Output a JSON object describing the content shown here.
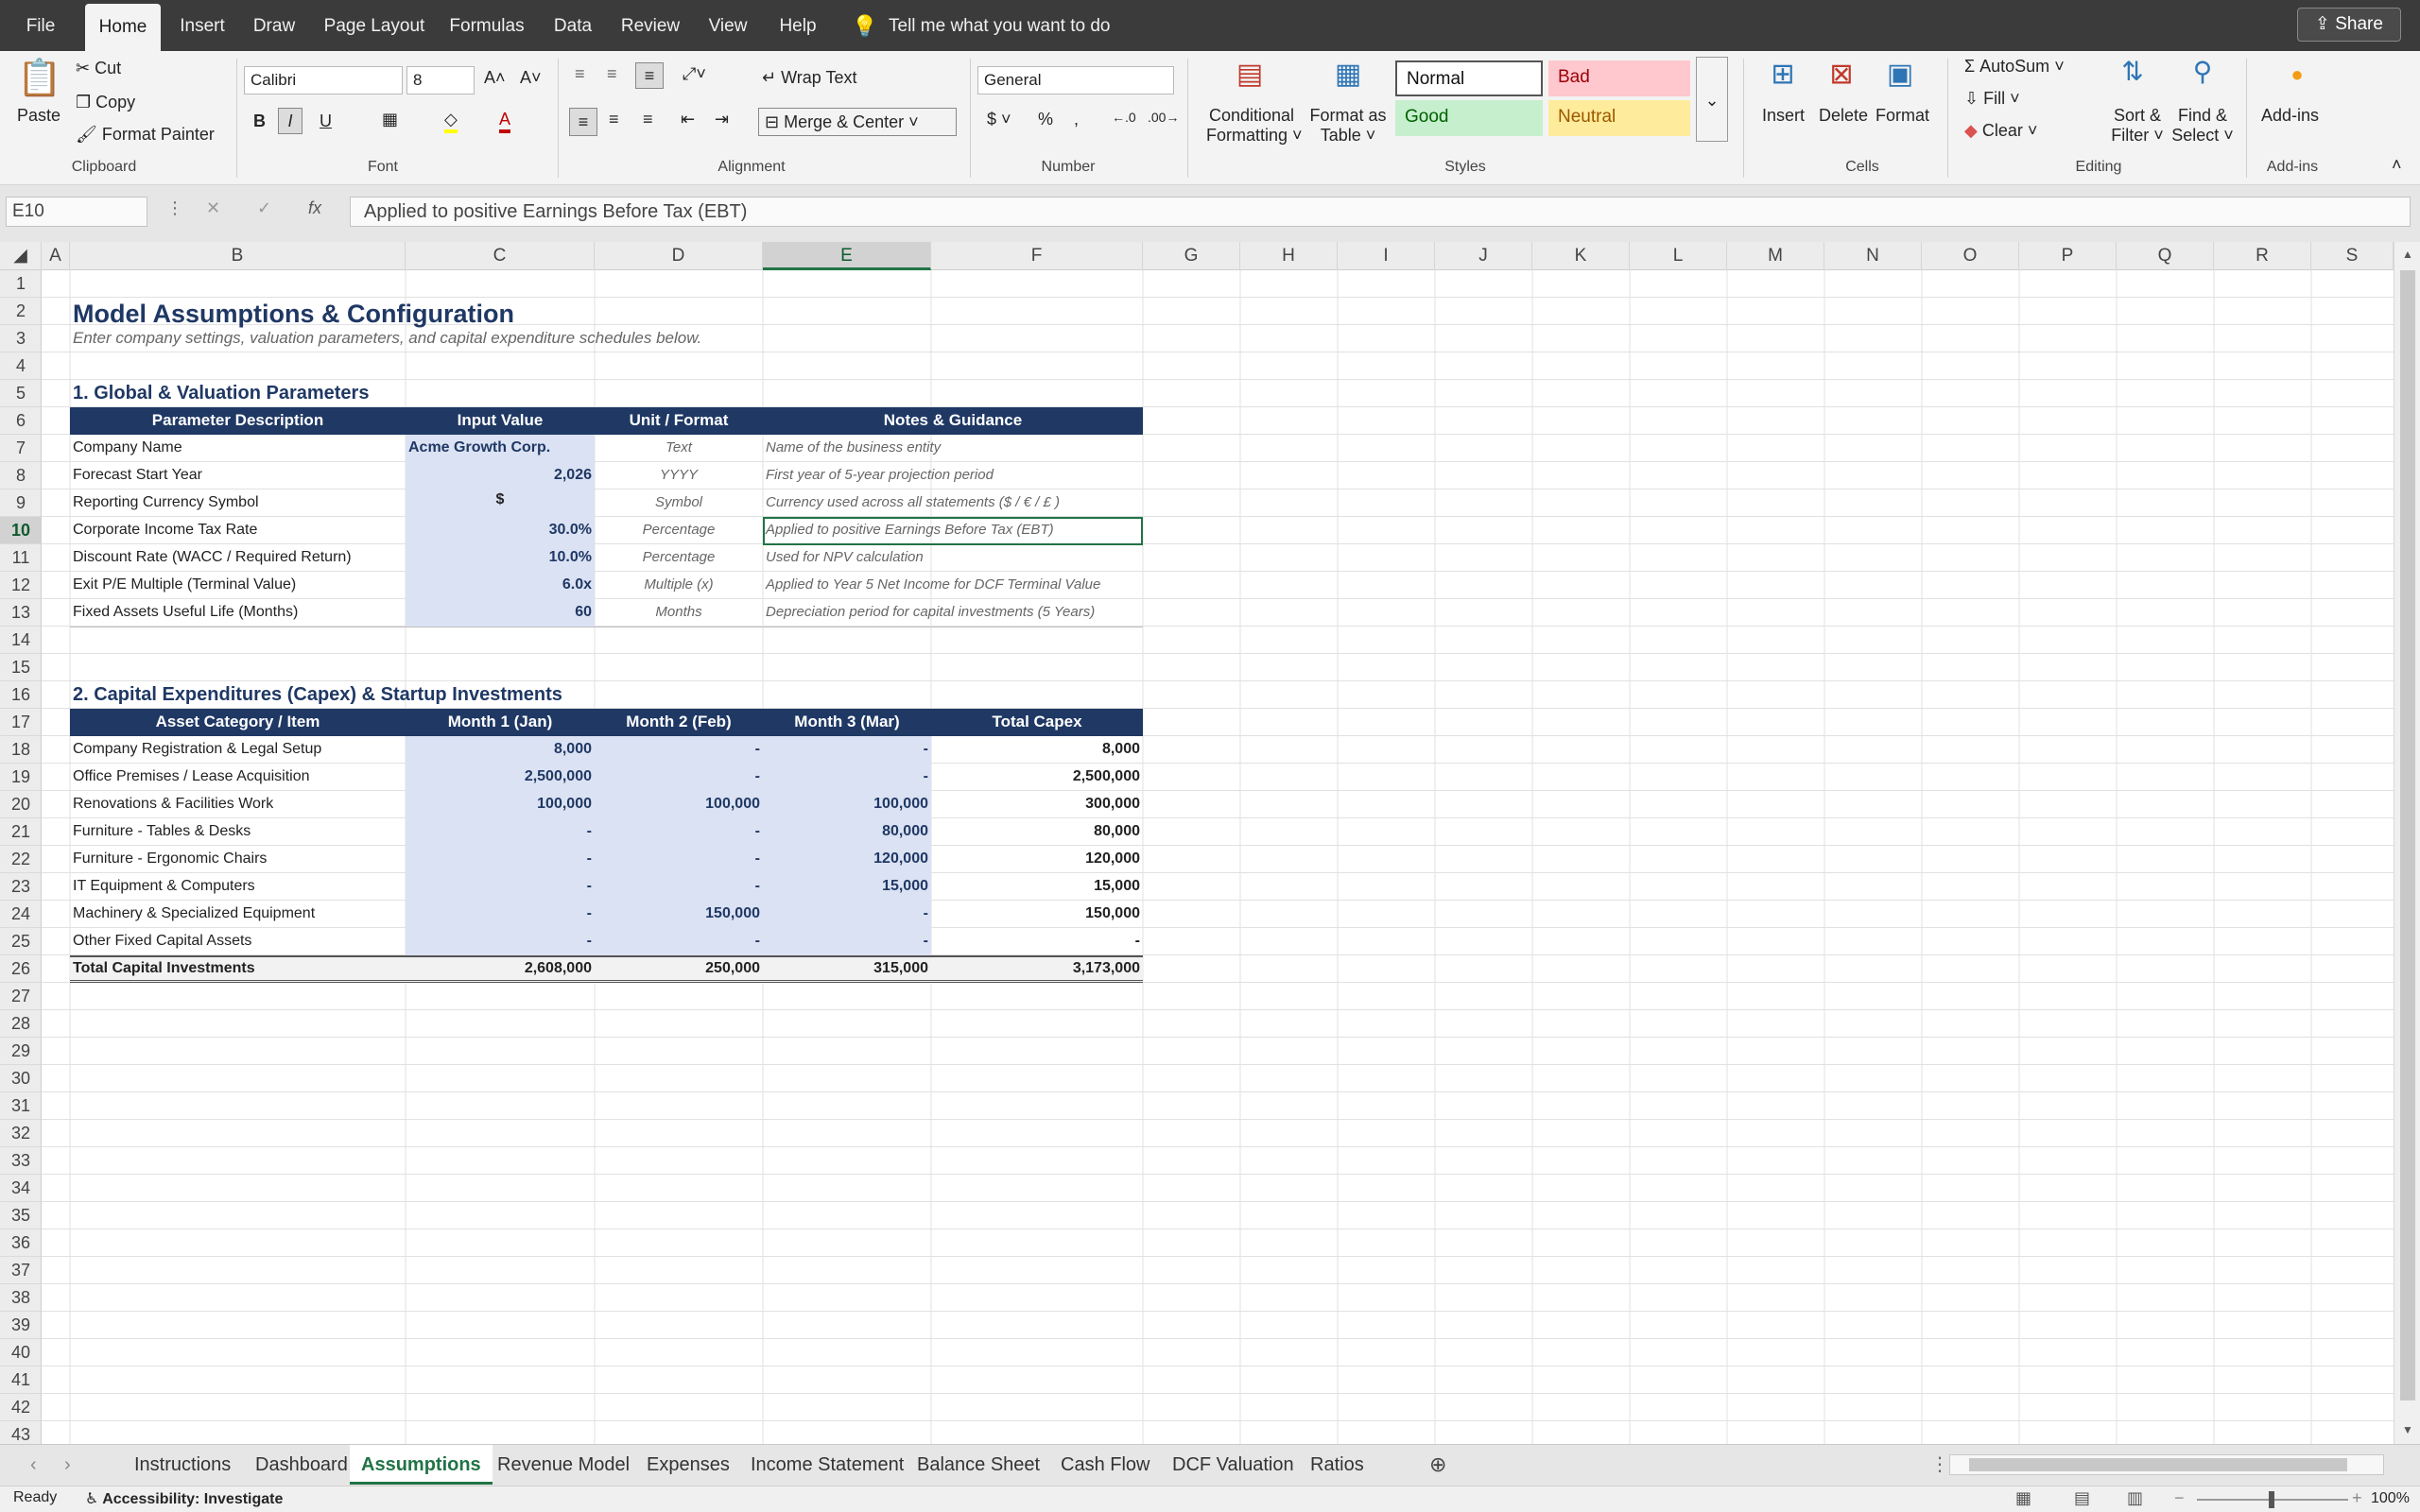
{
  "menu": {
    "tabs": [
      "File",
      "Home",
      "Insert",
      "Draw",
      "Page Layout",
      "Formulas",
      "Data",
      "Review",
      "View",
      "Help"
    ],
    "tell_me": "Tell me what you want to do",
    "share": "Share"
  },
  "ribbon": {
    "clipboard": {
      "paste": "Paste",
      "cut": "Cut",
      "copy": "Copy",
      "format_painter": "Format Painter",
      "group": "Clipboard"
    },
    "font": {
      "name": "Calibri",
      "size": "8",
      "bold": "B",
      "italic": "I",
      "underline": "U",
      "group": "Font"
    },
    "alignment": {
      "wrap_text": "Wrap Text",
      "merge_center": "Merge & Center",
      "group": "Alignment"
    },
    "number": {
      "format": "General",
      "group": "Number"
    },
    "styles": {
      "conditional": "Conditional",
      "conditional2": "Formatting",
      "format_table": "Format as",
      "format_table2": "Table",
      "normal": "Normal",
      "bad": "Bad",
      "good": "Good",
      "neutral": "Neutral",
      "group": "Styles"
    },
    "cells": {
      "insert": "Insert",
      "delete": "Delete",
      "format": "Format",
      "group": "Cells"
    },
    "editing": {
      "autosum": "AutoSum",
      "fill": "Fill",
      "clear": "Clear",
      "sort": "Sort &",
      "sort2": "Filter",
      "find": "Find &",
      "find2": "Select",
      "group": "Editing"
    },
    "addins": {
      "label": "Add-ins",
      "group": "Add-ins"
    }
  },
  "formula_bar": {
    "name_box": "E10",
    "formula": "Applied to positive Earnings Before Tax (EBT)"
  },
  "columns": [
    "A",
    "B",
    "C",
    "D",
    "E",
    "F",
    "G",
    "H",
    "I",
    "J",
    "K",
    "L",
    "M",
    "N",
    "O",
    "P",
    "Q",
    "R",
    "S"
  ],
  "rows": [
    "1",
    "2",
    "3",
    "4",
    "5",
    "6",
    "7",
    "8",
    "9",
    "10",
    "11",
    "12",
    "13",
    "14",
    "15",
    "16",
    "17",
    "18",
    "19",
    "20",
    "21",
    "22",
    "23",
    "24",
    "25",
    "26",
    "27",
    "28",
    "29",
    "30",
    "31",
    "32",
    "33",
    "34",
    "35",
    "36",
    "37",
    "38",
    "39",
    "40",
    "41",
    "42",
    "43"
  ],
  "sheet": {
    "title": "Model Assumptions & Configuration",
    "subtitle": "Enter company settings, valuation parameters, and capital expenditure schedules below.",
    "section1": "1. Global & Valuation Parameters",
    "params_headers": [
      "Parameter Description",
      "Input Value",
      "Unit / Format",
      "Notes & Guidance"
    ],
    "params": [
      {
        "desc": "Company Name",
        "value": "Acme Growth Corp.",
        "unit": "Text",
        "note": "Name of the business entity"
      },
      {
        "desc": "Forecast Start Year",
        "value": "2,026",
        "unit": "YYYY",
        "note": "First year of 5-year projection period"
      },
      {
        "desc": "Reporting Currency Symbol",
        "value": "$",
        "unit": "Symbol",
        "note": "Currency used across all statements ($ / € / £ )"
      },
      {
        "desc": "Corporate Income Tax Rate",
        "value": "30.0%",
        "unit": "Percentage",
        "note": "Applied to positive Earnings Before Tax (EBT)"
      },
      {
        "desc": "Discount Rate (WACC / Required Return)",
        "value": "10.0%",
        "unit": "Percentage",
        "note": "Used for NPV calculation"
      },
      {
        "desc": "Exit P/E Multiple (Terminal Value)",
        "value": "6.0x",
        "unit": "Multiple (x)",
        "note": "Applied to Year 5 Net Income for DCF Terminal Value"
      },
      {
        "desc": "Fixed Assets Useful Life (Months)",
        "value": "60",
        "unit": "Months",
        "note": "Depreciation period for capital investments (5 Years)"
      }
    ],
    "section2": "2. Capital Expenditures (Capex) & Startup Investments",
    "capex_headers": [
      "Asset Category / Item",
      "Month 1 (Jan)",
      "Month 2 (Feb)",
      "Month 3 (Mar)",
      "Total Capex"
    ],
    "capex": [
      {
        "item": "Company Registration & Legal Setup",
        "m1": "8,000",
        "m2": "-",
        "m3": "-",
        "total": "8,000"
      },
      {
        "item": "Office Premises / Lease Acquisition",
        "m1": "2,500,000",
        "m2": "-",
        "m3": "-",
        "total": "2,500,000"
      },
      {
        "item": "Renovations & Facilities Work",
        "m1": "100,000",
        "m2": "100,000",
        "m3": "100,000",
        "total": "300,000"
      },
      {
        "item": "Furniture - Tables & Desks",
        "m1": "-",
        "m2": "-",
        "m3": "80,000",
        "total": "80,000"
      },
      {
        "item": "Furniture - Ergonomic Chairs",
        "m1": "-",
        "m2": "-",
        "m3": "120,000",
        "total": "120,000"
      },
      {
        "item": "IT Equipment & Computers",
        "m1": "-",
        "m2": "-",
        "m3": "15,000",
        "total": "15,000"
      },
      {
        "item": "Machinery & Specialized Equipment",
        "m1": "-",
        "m2": "150,000",
        "m3": "-",
        "total": "150,000"
      },
      {
        "item": "Other Fixed Capital Assets",
        "m1": "-",
        "m2": "-",
        "m3": "-",
        "total": "-"
      }
    ],
    "capex_total": {
      "item": "Total Capital Investments",
      "m1": "2,608,000",
      "m2": "250,000",
      "m3": "315,000",
      "total": "3,173,000"
    }
  },
  "sheet_tabs": [
    "Instructions",
    "Dashboard",
    "Assumptions",
    "Revenue Model",
    "Expenses",
    "Income Statement",
    "Balance Sheet",
    "Cash Flow",
    "DCF Valuation",
    "Ratios"
  ],
  "active_tab": "Assumptions",
  "status": {
    "ready": "Ready",
    "accessibility": "Accessibility: Investigate",
    "zoom": "100%"
  },
  "colors": {
    "header_navy": "#1f3864",
    "input_blue": "#dbe2f3",
    "excel_green": "#217346"
  }
}
